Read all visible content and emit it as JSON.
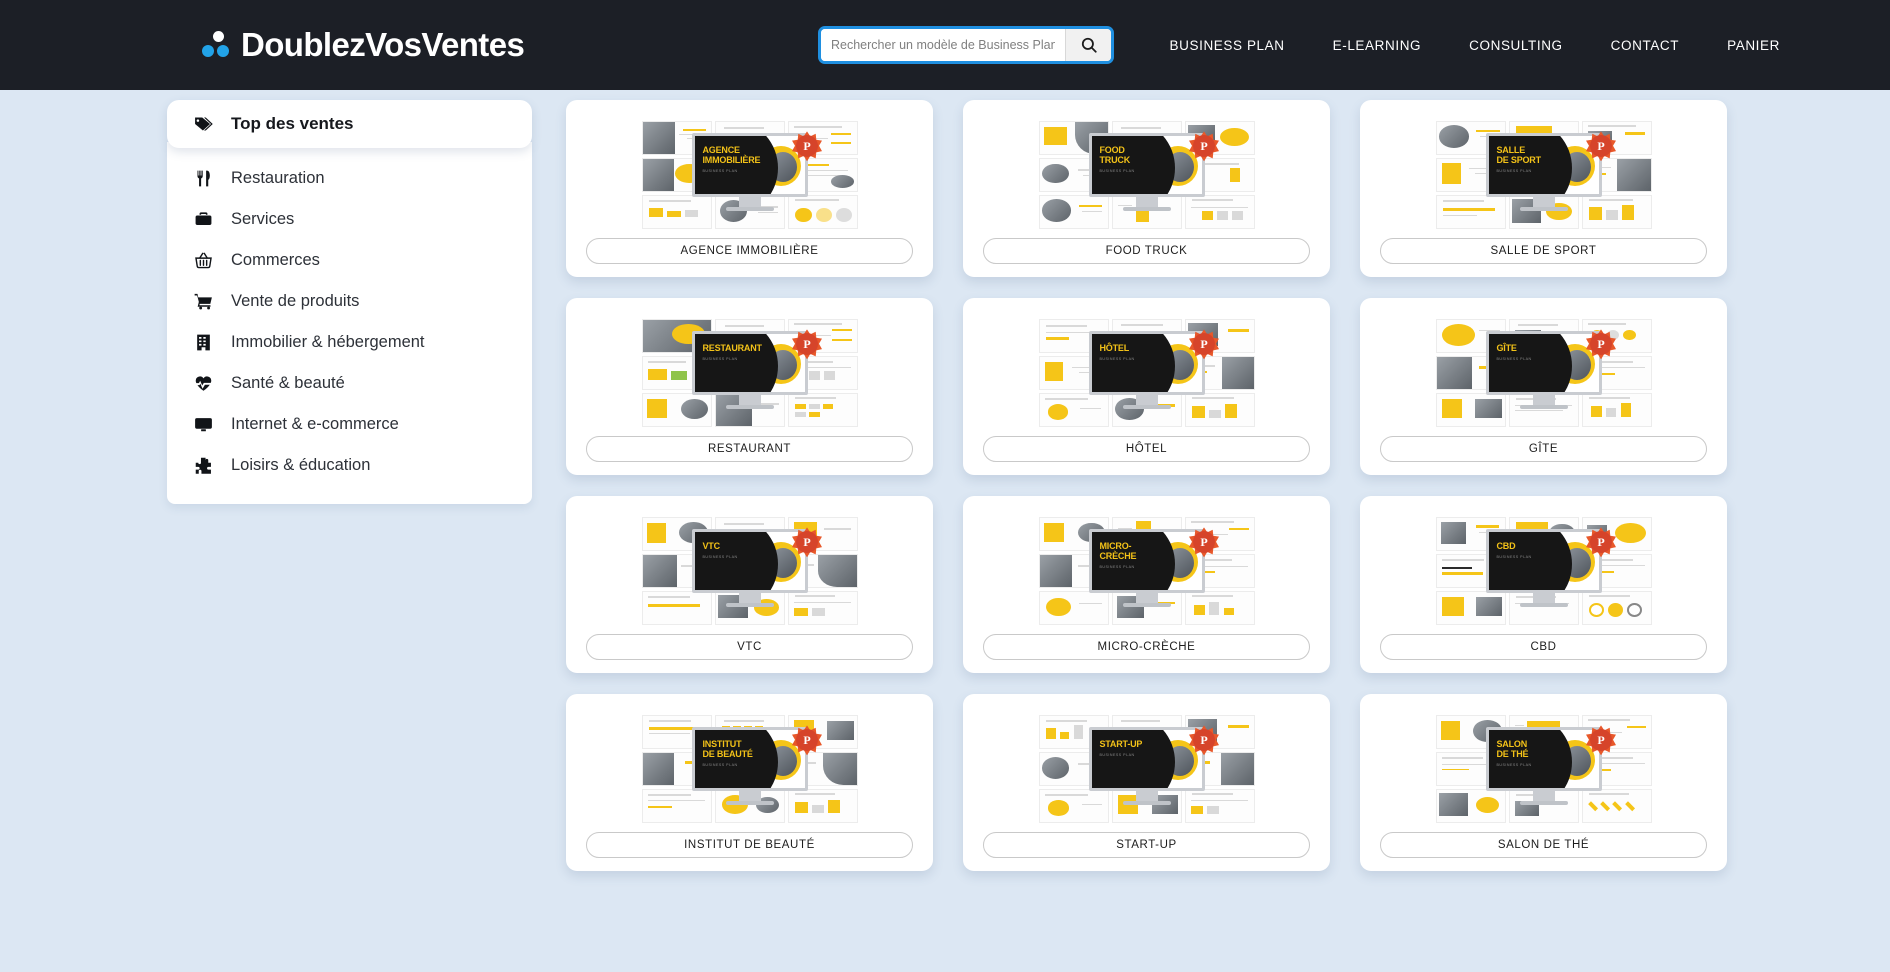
{
  "header": {
    "logo_text": "DoublezVosVentes",
    "logo_icon": "three-dots-logo",
    "search": {
      "placeholder": "Rechercher un modèle de Business Plan...etc.",
      "value": "",
      "icon": "search-icon"
    },
    "nav": [
      {
        "label": "BUSINESS PLAN"
      },
      {
        "label": "E-LEARNING"
      },
      {
        "label": "CONSULTING"
      },
      {
        "label": "CONTACT"
      },
      {
        "label": "PANIER"
      }
    ],
    "bg_color": "#1c1f26"
  },
  "sidebar": {
    "active": {
      "label": "Top des ventes",
      "icon": "tag-icon"
    },
    "items": [
      {
        "label": "Restauration",
        "icon": "fork-knife-icon"
      },
      {
        "label": "Services",
        "icon": "briefcase-icon"
      },
      {
        "label": "Commerces",
        "icon": "basket-icon"
      },
      {
        "label": "Vente de produits",
        "icon": "shopping-cart-icon"
      },
      {
        "label": "Immobilier & hébergement",
        "icon": "building-icon"
      },
      {
        "label": "Santé & beauté",
        "icon": "heartbeat-icon"
      },
      {
        "label": "Internet & e-commerce",
        "icon": "monitor-icon"
      },
      {
        "label": "Loisirs & éducation",
        "icon": "puzzle-icon"
      }
    ]
  },
  "grid": {
    "cards": [
      {
        "label": "AGENCE IMMOBILIÈRE",
        "screen_title": "AGENCE\nIMMOBILIÈRE"
      },
      {
        "label": "FOOD TRUCK",
        "screen_title": "FOOD\nTRUCK"
      },
      {
        "label": "SALLE DE SPORT",
        "screen_title": "SALLE\nDE SPORT"
      },
      {
        "label": "RESTAURANT",
        "screen_title": "RESTAURANT"
      },
      {
        "label": "HÔTEL",
        "screen_title": "HÔTEL"
      },
      {
        "label": "GÎTE",
        "screen_title": "GÎTE"
      },
      {
        "label": "VTC",
        "screen_title": "VTC"
      },
      {
        "label": "MICRO-CRÈCHE",
        "screen_title": "MICRO-CRÈCHE"
      },
      {
        "label": "CBD",
        "screen_title": "CBD"
      },
      {
        "label": "INSTITUT DE BEAUTÉ",
        "screen_title": "INSTITUT\nDE BEAUTÉ"
      },
      {
        "label": "START-UP",
        "screen_title": "START-UP"
      },
      {
        "label": "SALON DE THÉ",
        "screen_title": "SALON\nDE THÉ"
      }
    ],
    "badge_letter": "P",
    "badge_color": "#d6442a",
    "accent_color": "#f5c518",
    "page_bg": "#dce7f3"
  }
}
